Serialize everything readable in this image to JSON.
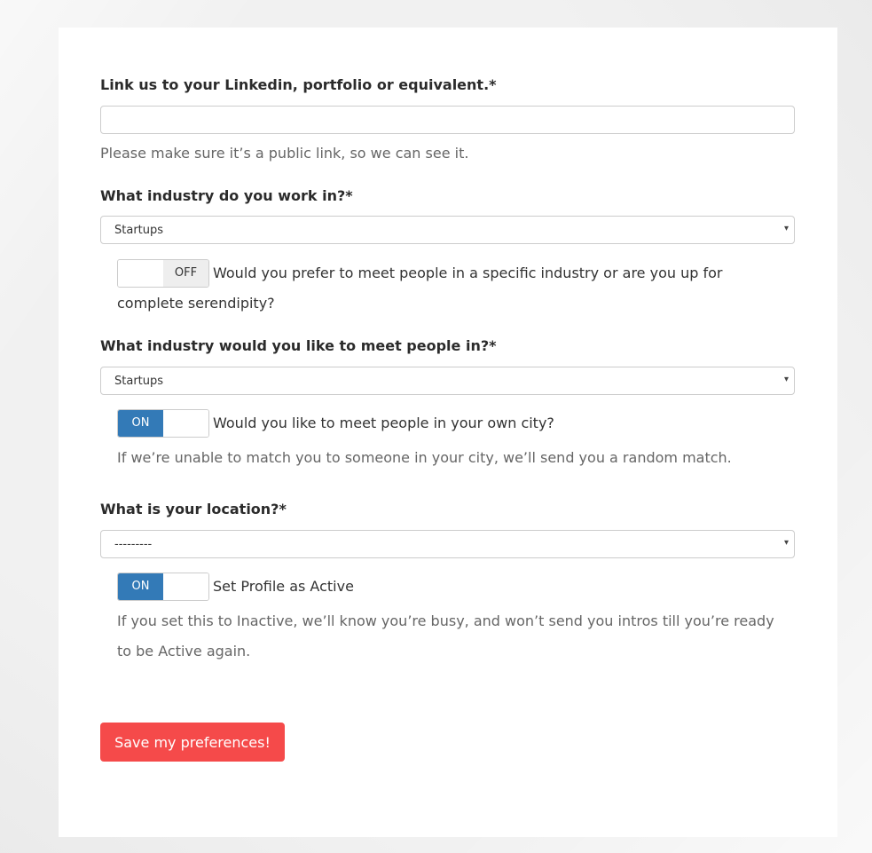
{
  "form": {
    "linkedin": {
      "label": "Link us to your Linkedin, portfolio or equivalent.*",
      "value": "",
      "help": "Please make sure it’s a public link, so we can see it."
    },
    "industry": {
      "label": "What industry do you work in?*",
      "selected": "Startups"
    },
    "specific_industry_toggle": {
      "state_label": "OFF",
      "state": "off",
      "question_line1": "Would you prefer to meet people in a specific industry or are you up for",
      "question_line2": "complete serendipity?"
    },
    "meet_industry": {
      "label": "What industry would you like to meet people in?*",
      "selected": "Startups"
    },
    "own_city_toggle": {
      "state_label": "ON",
      "state": "on",
      "question": "Would you like to meet people in your own city?",
      "help": "If we’re unable to match you to someone in your city, we’ll send you a random match."
    },
    "location": {
      "label": "What is your location?*",
      "selected": "---------"
    },
    "active_toggle": {
      "state_label": "ON",
      "state": "on",
      "label": "Set Profile as Active",
      "help_line1": "If you set this to Inactive, we’ll know you’re busy, and won’t send you intros till you’re ready",
      "help_line2": "to be Active again."
    },
    "save_label": "Save my preferences!"
  },
  "icons": {
    "select_caret": "▾"
  },
  "colors": {
    "accent_blue": "#337ab7",
    "save_red": "#f54a4a",
    "background": "#f1f1f1"
  }
}
